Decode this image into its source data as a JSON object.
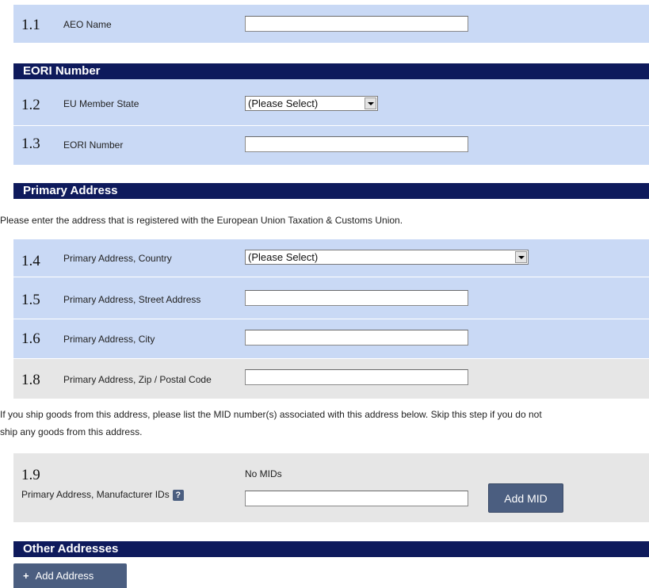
{
  "section_aeo": {
    "number": "1.1",
    "label": "AEO Name",
    "value": ""
  },
  "section_eori": {
    "header": "EORI Number",
    "member_state": {
      "number": "1.2",
      "label": "EU Member State",
      "selected": "(Please Select)"
    },
    "eori_number": {
      "number": "1.3",
      "label": "EORI Number",
      "value": ""
    }
  },
  "section_primary": {
    "header": "Primary Address",
    "intro": "Please enter the address that is registered with the European Union Taxation & Customs Union.",
    "country": {
      "number": "1.4",
      "label": "Primary Address, Country",
      "selected": "(Please Select)"
    },
    "street": {
      "number": "1.5",
      "label": "Primary Address, Street Address",
      "value": ""
    },
    "city": {
      "number": "1.6",
      "label": "Primary Address, City",
      "value": ""
    },
    "zip": {
      "number": "1.8",
      "label": "Primary Address, Zip / Postal Code",
      "value": ""
    },
    "mid_note_line1": "If you ship goods from this address, please list the MID number(s) associated with this address below. Skip this step if you do not",
    "mid_note_line2": "ship any goods from this address.",
    "mids": {
      "number": "1.9",
      "label": "Primary Address, Manufacturer IDs",
      "help_glyph": "?",
      "status": "No MIDs",
      "value": "",
      "add_button": "Add MID"
    }
  },
  "section_other": {
    "header": "Other Addresses",
    "add_icon": "plus-icon",
    "add_icon_glyph": "+",
    "add_button": "Add Address"
  },
  "colors": {
    "header_bg": "#0e1a5c",
    "row_blue": "#c9d9f5",
    "row_grey": "#e6e6e6",
    "button_bg": "#4b5e80"
  }
}
